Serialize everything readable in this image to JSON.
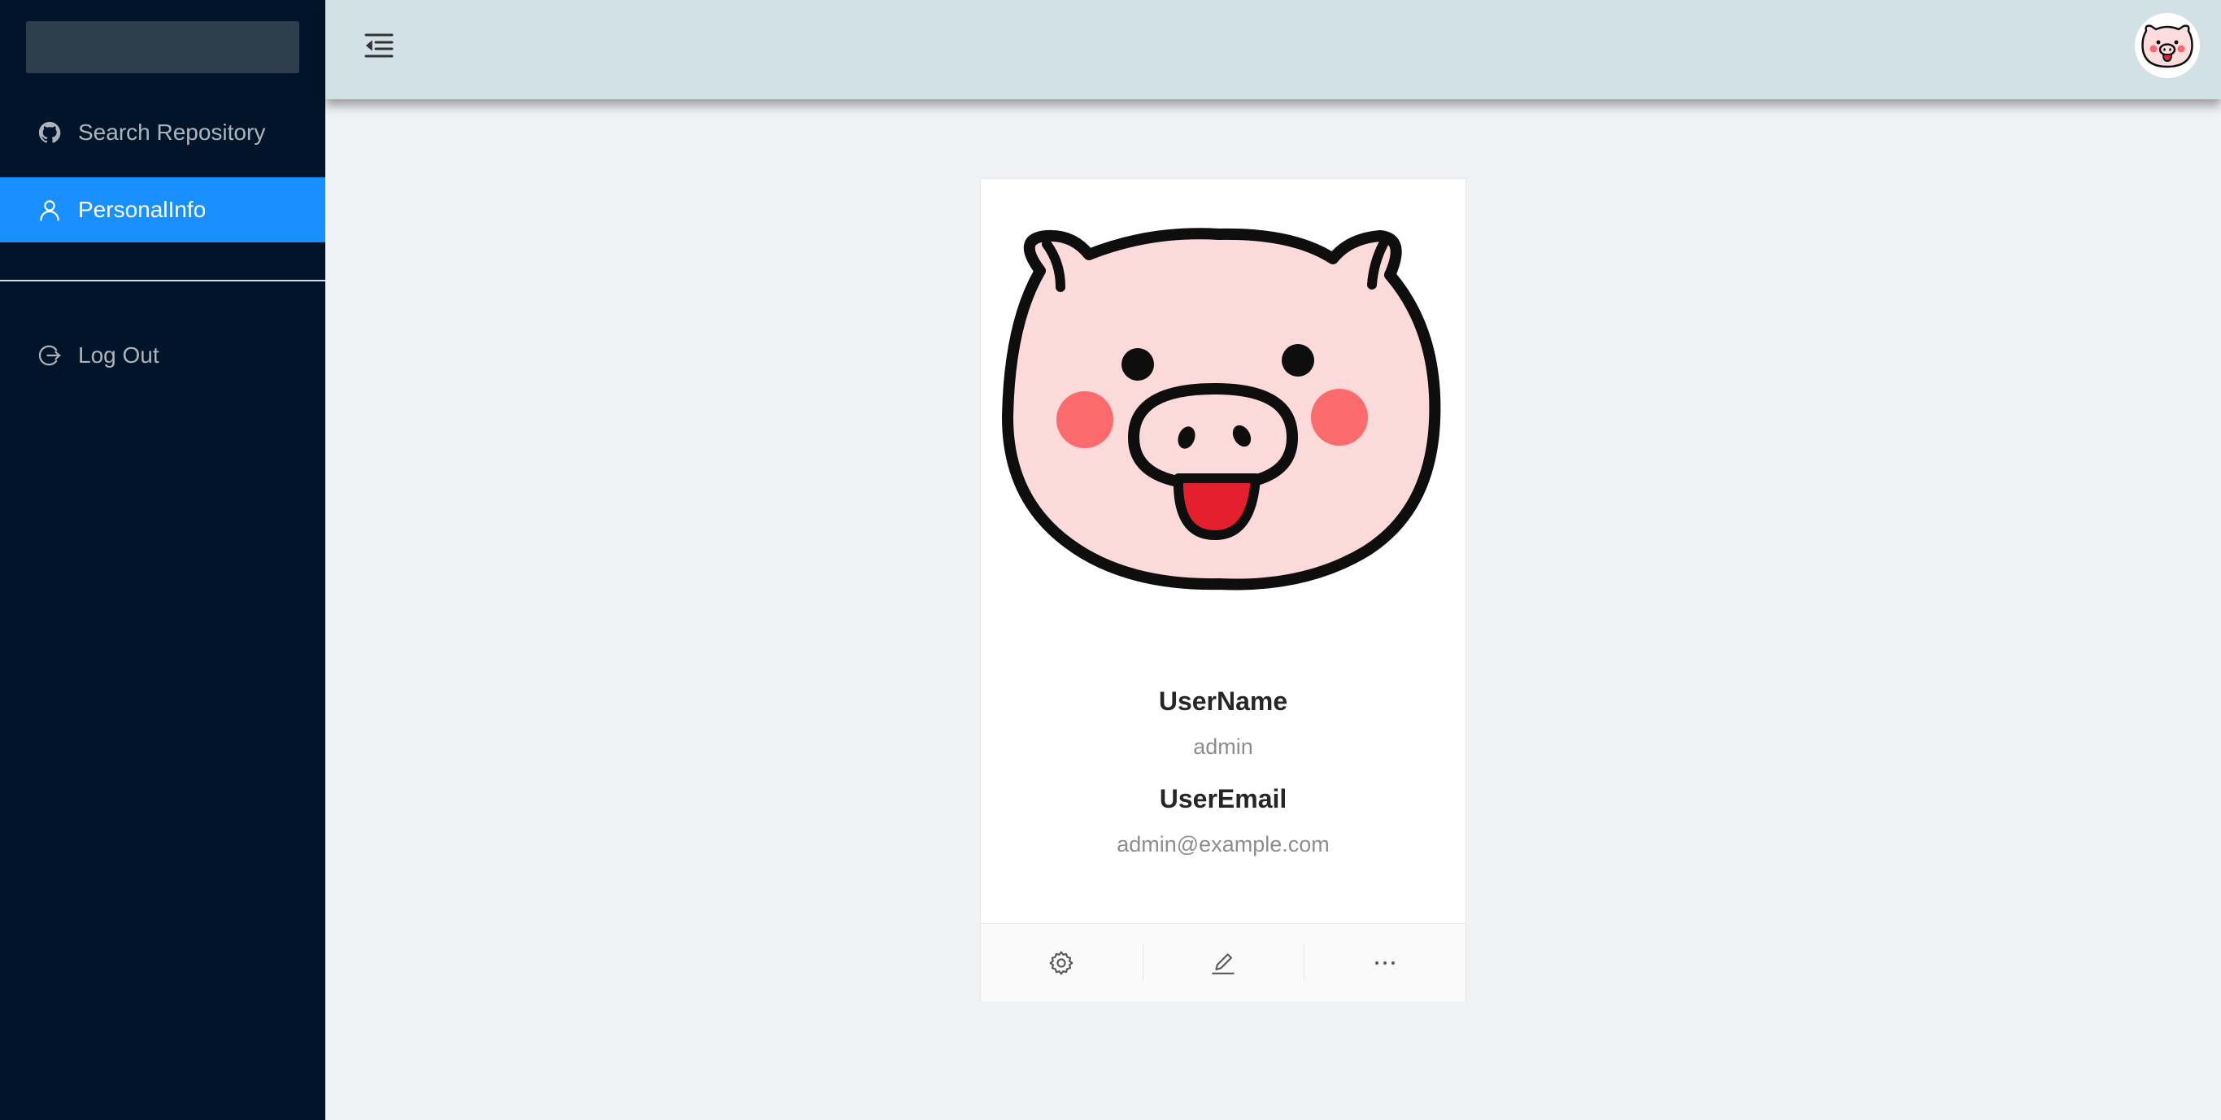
{
  "sidebar": {
    "items": [
      {
        "label": "Search Repository",
        "icon": "github-icon"
      },
      {
        "label": "PersonalInfo",
        "icon": "user-icon",
        "active": true
      },
      {
        "label": "Log Out",
        "icon": "logout-icon"
      }
    ]
  },
  "header": {
    "toggle_icon": "menu-fold-icon",
    "avatar_icon": "pig-avatar-icon"
  },
  "card": {
    "username_title": "UserName",
    "username_value": "admin",
    "email_title": "UserEmail",
    "email_value": "admin@example.com",
    "actions": [
      "setting-icon",
      "edit-icon",
      "ellipsis-icon"
    ]
  },
  "colors": {
    "sidebar_bg": "#001529",
    "active_item_bg": "#1890ff",
    "header_bg": "#d2e1e5",
    "page_bg": "#f0f2f5"
  }
}
